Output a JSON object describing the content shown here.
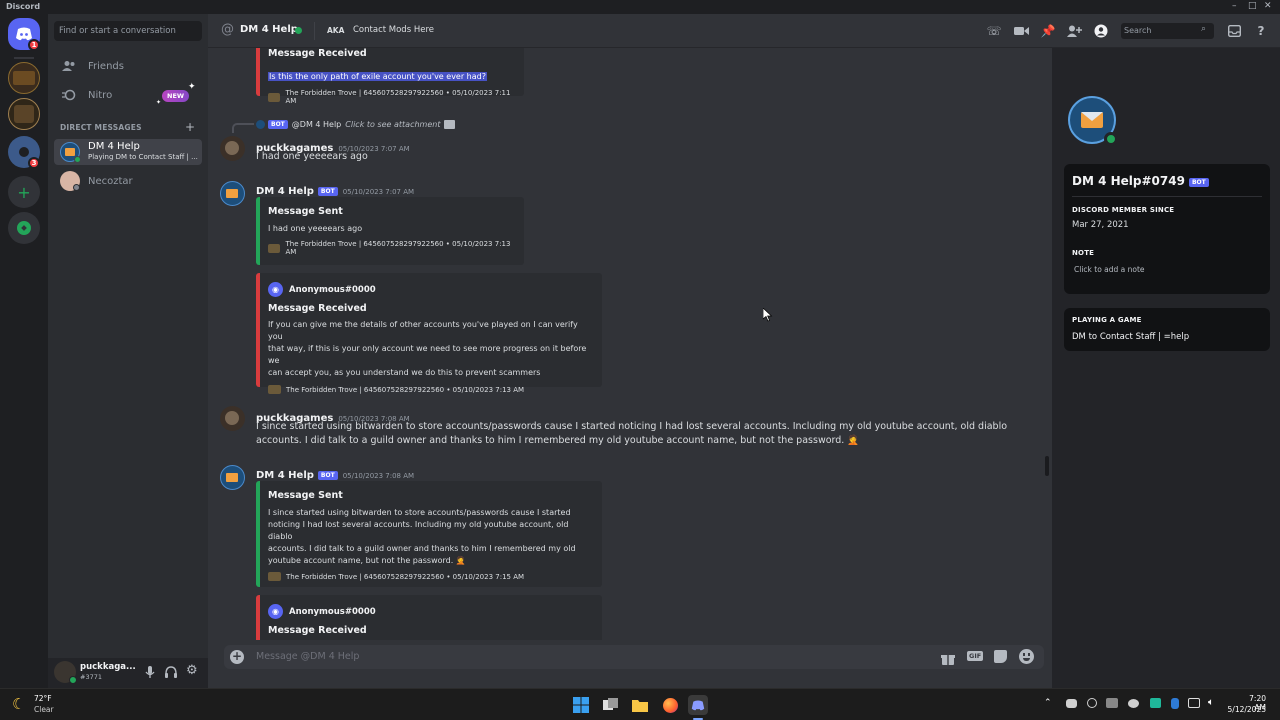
{
  "window": {
    "title": "Discord",
    "controls": [
      "–",
      "□",
      "✕"
    ]
  },
  "servers": {
    "home_badge": "1",
    "server3_badge": "3",
    "add_label": "+",
    "explore_label": "⊙"
  },
  "sidebar": {
    "search_placeholder": "Find or start a conversation",
    "friends_label": "Friends",
    "nitro_label": "Nitro",
    "nitro_badge": "NEW",
    "dm_header": "DIRECT MESSAGES",
    "dm_add": "+",
    "dms": [
      {
        "name": "DM 4 Help",
        "status": "Playing DM to Contact Staff | ..."
      },
      {
        "name": "Necoztar",
        "status": ""
      }
    ]
  },
  "user": {
    "name": "puckkaga...",
    "tag": "#3771"
  },
  "header": {
    "channel": "DM 4 Help",
    "aka_label": "AKA",
    "aka_value": "Contact Mods Here",
    "search_placeholder": "Search"
  },
  "messages": {
    "top_embed": {
      "title": "Message Received",
      "highlighted": "Is this the only path of exile account you've ever had?",
      "footer": "The Forbidden Trove | 645607528297922560 • 05/10/2023 7:11 AM"
    },
    "reply_ref": {
      "bot": "BOT",
      "mention": "@DM 4 Help",
      "text": "Click to see attachment"
    },
    "m1": {
      "author": "puckkagames",
      "time": "05/10/2023 7:07 AM",
      "text": "I had one yeeeears ago"
    },
    "m2": {
      "author": "DM 4 Help",
      "bot": "BOT",
      "time": "05/10/2023 7:07 AM",
      "embed1": {
        "title": "Message Sent",
        "desc": "I had one yeeeears ago",
        "footer": "The Forbidden Trove | 645607528297922560 • 05/10/2023 7:13 AM"
      },
      "embed2": {
        "author": "Anonymous#0000",
        "title": "Message Received",
        "desc": [
          "If you can give me the details of other accounts you've played on I can verify you",
          "that way, if this is your only account we need to see more progress on it before we",
          "can accept you, as you understand we do this to prevent scammers"
        ],
        "footer": "The Forbidden Trove | 645607528297922560 • 05/10/2023 7:13 AM"
      }
    },
    "m3": {
      "author": "puckkagames",
      "time": "05/10/2023 7:08 AM",
      "lines": [
        "I since started using bitwarden to store accounts/passwords cause I started noticing I had lost several accounts. Including my old youtube account, old diablo",
        "accounts. I did talk to a guild owner and thanks to him I remembered my old youtube account name, but not the password. 🤦"
      ]
    },
    "m4": {
      "author": "DM 4 Help",
      "bot": "BOT",
      "time": "05/10/2023 7:08 AM",
      "embed1": {
        "title": "Message Sent",
        "desc": [
          "I since started using bitwarden to store accounts/passwords cause I started",
          "noticing I had lost several accounts. Including my old youtube account, old diablo",
          "accounts. I did talk to a guild owner and thanks to him I remembered my old",
          "youtube account name, but not the password. 🤦"
        ],
        "footer": "The Forbidden Trove | 645607528297922560 • 05/10/2023 7:15 AM"
      },
      "embed2": {
        "author": "Anonymous#0000",
        "title": "Message Received"
      }
    }
  },
  "composer": {
    "placeholder": "Message @DM 4 Help",
    "gif": "GIF"
  },
  "profile": {
    "name": "DM 4 Help#0749",
    "bot": "BOT",
    "member_since_label": "DISCORD MEMBER SINCE",
    "member_since": "Mar 27, 2021",
    "note_label": "NOTE",
    "note_placeholder": "Click to add a note",
    "playing_label": "PLAYING A GAME",
    "playing_value": "DM to Contact Staff | =help"
  },
  "taskbar": {
    "weather_temp": "72°F",
    "weather_desc": "Clear",
    "time": "7:20 AM",
    "date": "5/12/2023"
  }
}
